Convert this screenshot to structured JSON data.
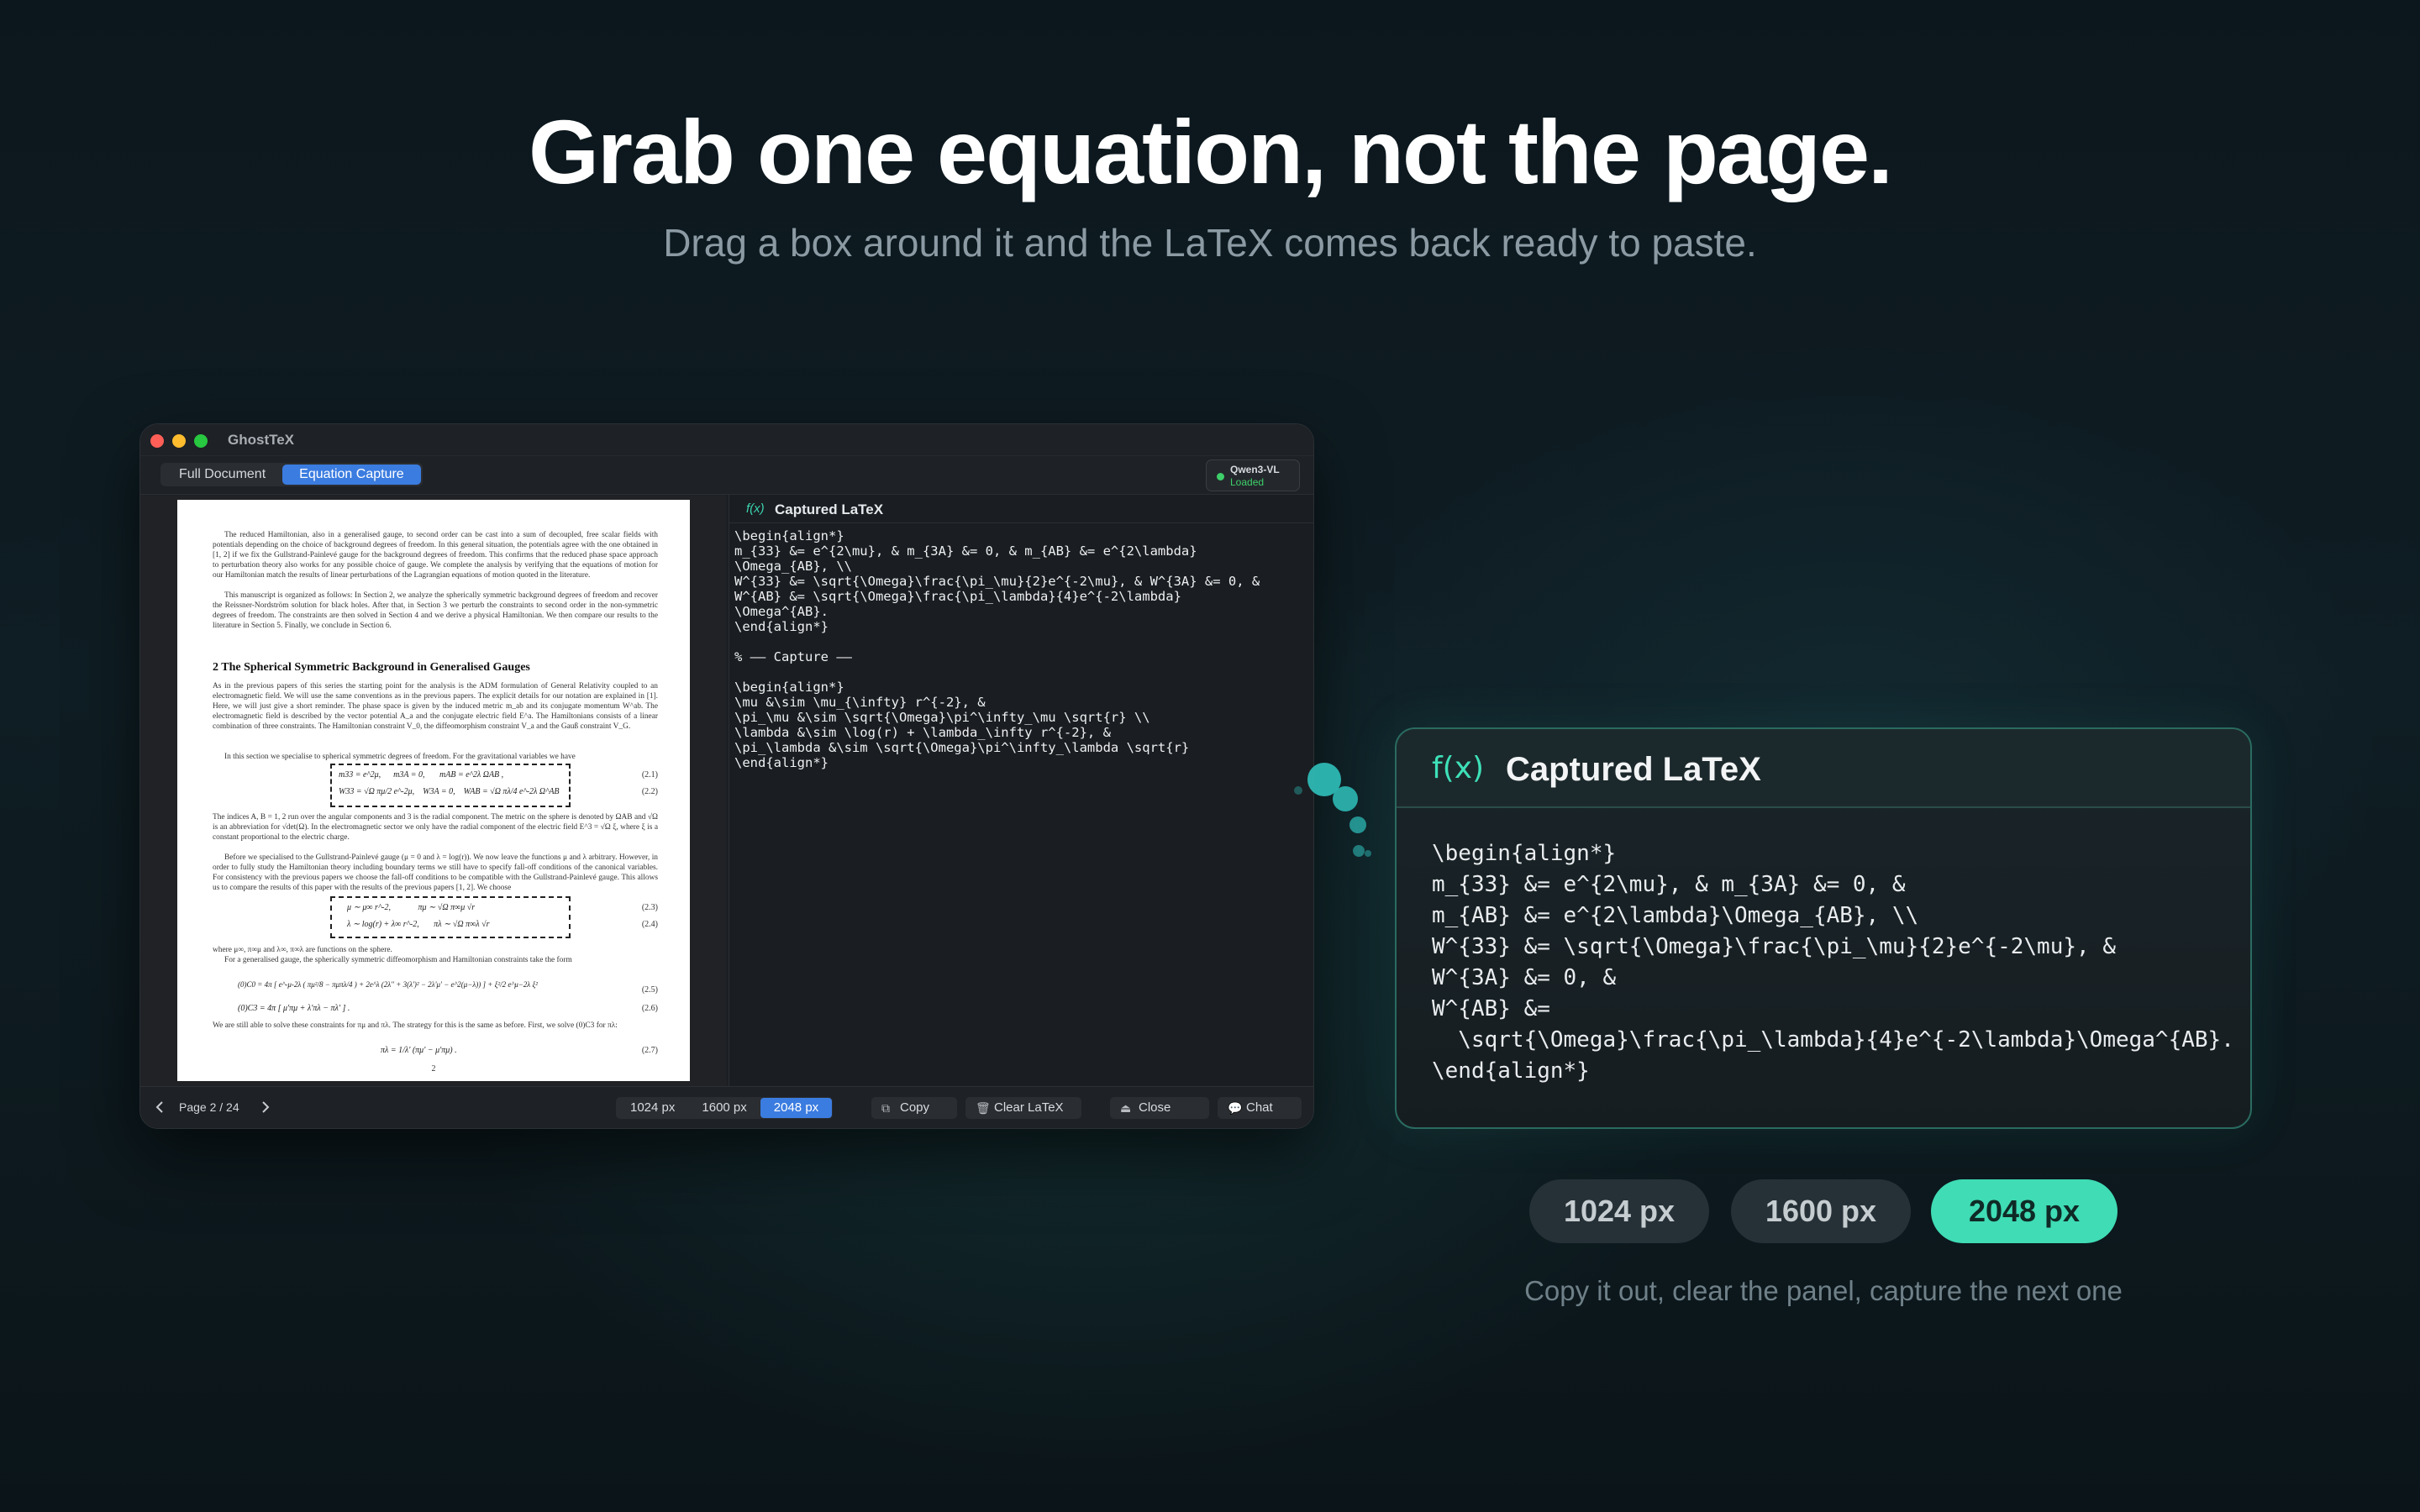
{
  "hero": {
    "title": "Grab one equation, not the page.",
    "subtitle": "Drag a box around it and the LaTeX comes back ready to paste."
  },
  "window": {
    "app_title": "GhostTeX",
    "tabs": [
      {
        "label": "Full Document",
        "active": false
      },
      {
        "label": "Equation Capture",
        "active": true
      }
    ],
    "model": {
      "name": "Qwen3-VL",
      "status": "Loaded",
      "status_color": "#3ecf6a"
    },
    "pdf": {
      "paragraphs": [
        "The reduced Hamiltonian, also in a generalised gauge, to second order can be cast into a sum of decoupled, free scalar fields with potentials depending on the choice of background degrees of freedom. In this general situation, the potentials agree with the one obtained in [1, 2] if we fix the Gullstrand-Painlevé gauge for the background degrees of freedom. This confirms that the reduced phase space approach to perturbation theory also works for any possible choice of gauge. We complete the analysis by verifying that the equations of motion for our Hamiltonian match the results of linear perturbations of the Lagrangian equations of motion quoted in the literature.",
        "This manuscript is organized as follows: In Section 2, we analyze the spherically symmetric background degrees of freedom and recover the Reissner-Nordström solution for black holes. After that, in Section 3 we perturb the constraints to second order in the non-symmetric degrees of freedom. The constraints are then solved in Section 4 and we derive a physical Hamiltonian. We then compare our results to the literature in Section 5. Finally, we conclude in Section 6."
      ],
      "heading": "2   The Spherical Symmetric Background in Generalised Gauges",
      "paragraphs2": [
        "As in the previous papers of this series the starting point for the analysis is the ADM formulation of General Relativity coupled to an electromagnetic field. We will use the same conventions as in the previous papers. The explicit details for our notation are explained in [1]. Here, we will just give a short reminder. The phase space is given by the induced metric m_ab and its conjugate momentum W^ab. The electromagnetic field is described by the vector potential A_a and the conjugate electric field E^a. The Hamiltonians consists of a linear combination of three constraints. The Hamiltonian constraint V_0, the diffeomorphism constraint V_a and the Gauß constraint V_G.",
        "In this section we specialise to spherical symmetric degrees of freedom. For the gravitational variables we have"
      ],
      "equations": [
        {
          "text": "m33 = e^2μ,      m3A = 0,       mAB = e^2λ ΩAB ,",
          "num": "(2.1)"
        },
        {
          "text": "W33 = √Ω πμ/2 e^-2μ,    W3A = 0,    WAB = √Ω πλ/4 e^-2λ Ω^AB",
          "num": "(2.2)"
        }
      ],
      "paragraphs3": [
        "The indices A, B = 1, 2 run over the angular components and 3 is the radial component. The metric on the sphere is denoted by ΩAB and √Ω is an abbreviation for √det(Ω). In the electromagnetic sector we only have the radial component of the electric field E^3 = √Ω ξ, where ξ is a constant proportional to the electric charge.",
        "Before we specialised to the Gullstrand-Painlevé gauge (μ = 0 and λ = log(r)). We now leave the functions μ and λ arbitrary. However, in order to fully study the Hamiltonian theory including boundary terms we still have to specify fall-off conditions of the canonical variables. For consistency with the previous papers we choose the fall-off conditions to be compatible with the Gullstrand-Painlevé gauge. This allows us to compare the results of this paper with the results of the previous papers [1, 2]. We choose"
      ],
      "equations2": [
        {
          "text": "μ ∼ μ∞ r^-2,             πμ ∼ √Ω π∞μ √r",
          "num": "(2.3)"
        },
        {
          "text": "λ ∼ log(r) + λ∞ r^-2,       πλ ∼ √Ω π∞λ √r",
          "num": "(2.4)"
        }
      ],
      "paragraphs4": [
        "where μ∞, π∞μ and λ∞, π∞λ are functions on the sphere.",
        "For a generalised gauge, the spherically symmetric diffeomorphism and Hamiltonian constraints take the form"
      ],
      "equations3": [
        {
          "text": "(0)C0 = 4π [ e^-μ-2λ ( πμ²/8 − πμπλ/4 ) + 2e^λ (2λ'' + 3(λ')² − 2λ'μ' − e^2(μ−λ)) ] + ξ²/2 e^μ−2λ ξ²",
          "num": "(2.5)"
        },
        {
          "text": "(0)C3 = 4π [ μ'πμ + λ'πλ − πλ' ] .",
          "num": "(2.6)"
        }
      ],
      "paragraph5": "We are still able to solve these constraints for πμ and πλ. The strategy for this is the same as before. First, we solve (0)C3 for πλ:",
      "equation4": {
        "text": "πλ = 1/λ' (πμ' − μ'πμ) .",
        "num": "(2.7)"
      },
      "page_number": "2"
    },
    "latex_panel": {
      "icon": "f(x)",
      "title": "Captured LaTeX",
      "code": "\\begin{align*}\nm_{33} &= e^{2\\mu}, & m_{3A} &= 0, & m_{AB} &= e^{2\\lambda}\n\\Omega_{AB}, \\\\\nW^{33} &= \\sqrt{\\Omega}\\frac{\\pi_\\mu}{2}e^{-2\\mu}, & W^{3A} &= 0, &\nW^{AB} &= \\sqrt{\\Omega}\\frac{\\pi_\\lambda}{4}e^{-2\\lambda}\n\\Omega^{AB}.\n\\end{align*}\n\n% —— Capture ——\n\n\\begin{align*}\n\\mu &\\sim \\mu_{\\infty} r^{-2}, &\n\\pi_\\mu &\\sim \\sqrt{\\Omega}\\pi^\\infty_\\mu \\sqrt{r} \\\\\n\\lambda &\\sim \\log(r) + \\lambda_\\infty r^{-2}, &\n\\pi_\\lambda &\\sim \\sqrt{\\Omega}\\pi^\\infty_\\lambda \\sqrt{r}\n\\end{align*}"
    },
    "statusbar": {
      "page_label": "Page 2 / 24",
      "resolutions": [
        {
          "label": "1024 px",
          "active": false
        },
        {
          "label": "1600 px",
          "active": false
        },
        {
          "label": "2048 px",
          "active": true
        }
      ],
      "copy_label": "Copy",
      "clear_label": "Clear LaTeX",
      "close_label": "Close",
      "chat_label": "Chat"
    }
  },
  "card": {
    "icon": "f(x)",
    "title": "Captured LaTeX",
    "code": "\\begin{align*}\nm_{33} &= e^{2\\mu}, & m_{3A} &= 0, &\nm_{AB} &= e^{2\\lambda}\\Omega_{AB}, \\\\\nW^{33} &= \\sqrt{\\Omega}\\frac{\\pi_\\mu}{2}e^{-2\\mu}, &\nW^{3A} &= 0, &\nW^{AB} &=\n  \\sqrt{\\Omega}\\frac{\\pi_\\lambda}{4}e^{-2\\lambda}\\Omega^{AB}.\n\\end{align*}"
  },
  "resolution_pills": [
    {
      "label": "1024 px",
      "active": false
    },
    {
      "label": "1600 px",
      "active": false
    },
    {
      "label": "2048 px",
      "active": true
    }
  ],
  "caption": "Copy it out, clear the panel, capture the next one",
  "colors": {
    "accent": "#3b7ce0",
    "teal": "#3fdcb5",
    "card_border": "#2a6b60"
  }
}
